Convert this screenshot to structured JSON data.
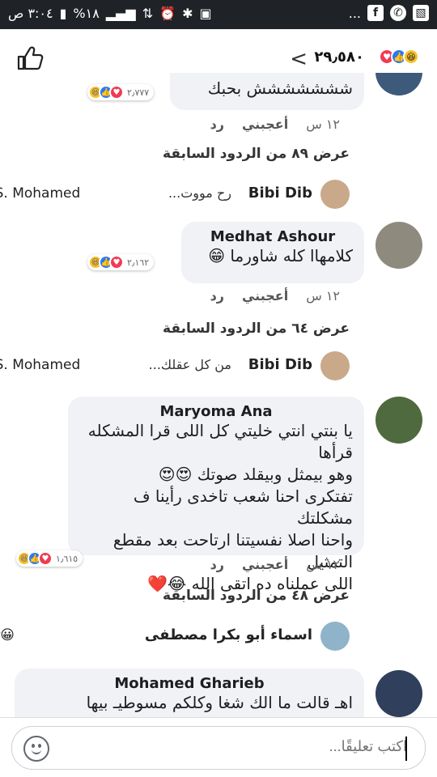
{
  "statusbar": {
    "time": "٣:٠٤ ص",
    "battery": "%١٨",
    "right_icons": [
      "gallery-icon",
      "whatsapp-icon",
      "facebook-icon",
      "more-dots"
    ],
    "more": "..."
  },
  "header": {
    "reaction_count": "٢٩٫٥٨٠",
    "back_symbol": "<"
  },
  "comments": [
    {
      "text_partial": "ششششششش بحبك",
      "reaction_count": "٢٫٧٧٧",
      "time": "١٢ س",
      "like_label": "أعجبني",
      "reply_label": "رد",
      "prev_replies": "عرض ٨٩ من الردود السابقة",
      "reply_preview": {
        "name": "Bibi Dib",
        "text": "رح مووت...",
        "to": "Ahmed S. Mohamed"
      }
    },
    {
      "author": "Medhat Ashour",
      "text": "كلامهاا كله شاورما 😁",
      "reaction_count": "٢٫١٦٢",
      "time": "١٢ س",
      "like_label": "أعجبني",
      "reply_label": "رد",
      "prev_replies": "عرض ٦٤ من الردود السابقة",
      "reply_preview": {
        "name": "Bibi Dib",
        "text": "من كل عقلك...",
        "to": "Ahmed S. Mohamed"
      }
    },
    {
      "author": "Maryoma Ana",
      "lines": [
        "يا بنتي انتي خليتي كل اللى قرا المشكله قرأها",
        "وهو بيمثل وبيقلد صوتك 😍😍",
        "تفتكرى احنا شعب تاخدى رأينا ف مشكلتك",
        "واحنا اصلا نفسيتنا ارتاحت بعد مقطع التمثيل",
        "اللى عملناه ده اتقى الله 😂❤️"
      ],
      "reaction_count": "١٫٦١٥",
      "time": "١٢ س",
      "like_label": "أعجبني",
      "reply_label": "رد",
      "prev_replies": "عرض ٤٨ من الردود السابقة",
      "reply_preview": {
        "name": "اسماء أبو بكرا مصطفى",
        "text": "",
        "to": "Hala Bkr😀"
      }
    },
    {
      "author": "Mohamed Gharieb",
      "text_partial": "اهـ قالت ما الك شغا وكلكم مسوطيـ بيها"
    }
  ],
  "composer": {
    "placeholder": "اكتب تعليقًا..."
  },
  "colors": {
    "bubble": "#f0f2f5",
    "like_blue": "#2a7bf2",
    "love_red": "#f23a52",
    "haha_yellow": "#f7c02b"
  }
}
